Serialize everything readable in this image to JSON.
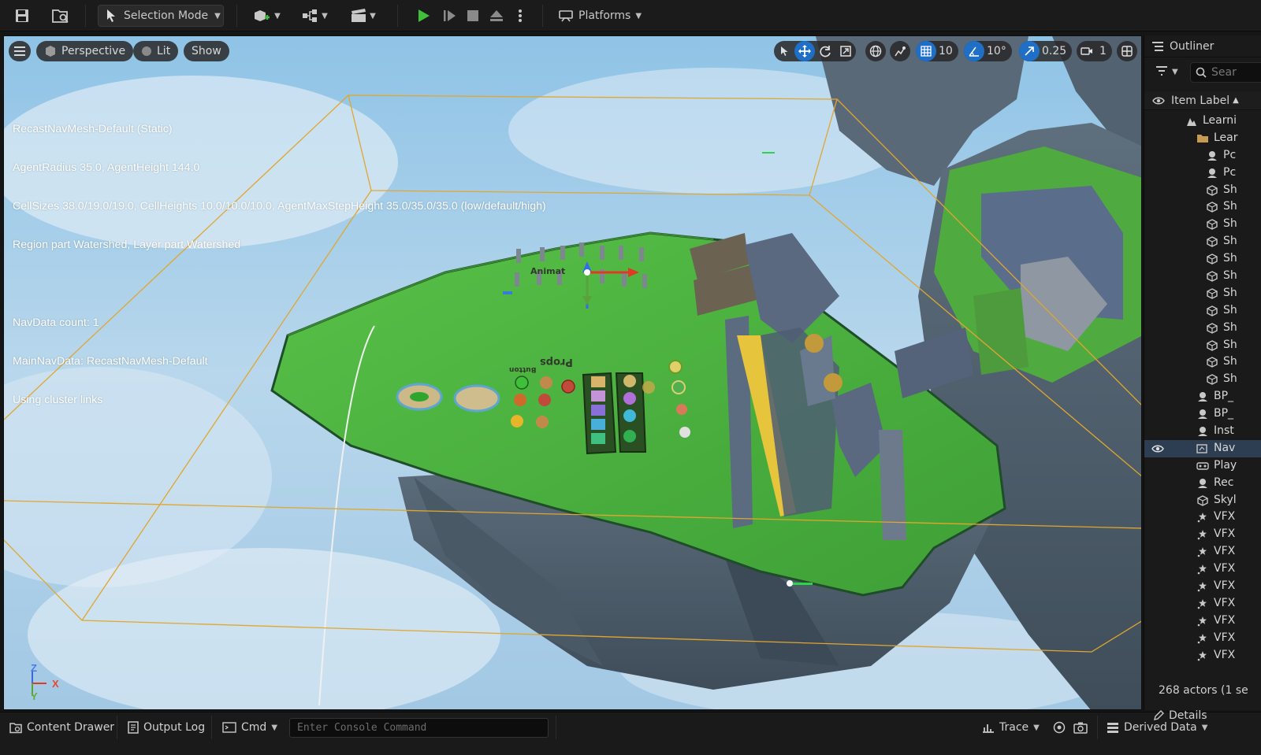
{
  "toolbar": {
    "selection_mode": "Selection Mode",
    "platforms": "Platforms"
  },
  "viewport": {
    "menu_icon": "hamburger-icon",
    "perspective": "Perspective",
    "lit": "Lit",
    "show": "Show",
    "grid_snap": "10",
    "rotation_snap": "10°",
    "scale_snap": "0.25",
    "camera_speed": "1",
    "nav_info": [
      "RecastNavMesh-Default (Static)",
      "AgentRadius 35.0, AgentHeight 144.0",
      "CellSizes 38.0/19.0/19.0, CellHeights 10.0/10.0/10.0, AgentMaxStepHeight 35.0/35.0/35.0 (low/default/high)",
      "Region part Watershed, Layer part Watershed",
      "",
      "NavData count: 1",
      "MainNavData: RecastNavMesh-Default",
      "Using cluster links"
    ],
    "scene_labels": {
      "animation": "Animat",
      "props": "Props",
      "button": "Button"
    },
    "axis": {
      "z": "Z",
      "x": "X",
      "y": "Y"
    }
  },
  "outliner": {
    "title": "Outliner",
    "search_placeholder": "Sear",
    "column_label": "Item Label",
    "rows": [
      {
        "label": "Learni",
        "icon": "level-icon",
        "indent": 1
      },
      {
        "label": "Lear",
        "icon": "folder-icon",
        "indent": 2
      },
      {
        "label": "Pc",
        "icon": "actor-icon",
        "indent": 3
      },
      {
        "label": "Pc",
        "icon": "actor-icon",
        "indent": 3
      },
      {
        "label": "Sh",
        "icon": "static-mesh-icon",
        "indent": 3
      },
      {
        "label": "Sh",
        "icon": "static-mesh-icon",
        "indent": 3
      },
      {
        "label": "Sh",
        "icon": "static-mesh-icon",
        "indent": 3
      },
      {
        "label": "Sh",
        "icon": "static-mesh-icon",
        "indent": 3
      },
      {
        "label": "Sh",
        "icon": "static-mesh-icon",
        "indent": 3
      },
      {
        "label": "Sh",
        "icon": "static-mesh-icon",
        "indent": 3
      },
      {
        "label": "Sh",
        "icon": "static-mesh-icon",
        "indent": 3
      },
      {
        "label": "Sh",
        "icon": "static-mesh-icon",
        "indent": 3
      },
      {
        "label": "Sh",
        "icon": "static-mesh-icon",
        "indent": 3
      },
      {
        "label": "Sh",
        "icon": "static-mesh-icon",
        "indent": 3
      },
      {
        "label": "Sh",
        "icon": "static-mesh-icon",
        "indent": 3
      },
      {
        "label": "Sh",
        "icon": "static-mesh-icon",
        "indent": 3
      },
      {
        "label": "BP_",
        "icon": "actor-icon",
        "indent": 2
      },
      {
        "label": "BP_",
        "icon": "actor-icon",
        "indent": 2
      },
      {
        "label": "Inst",
        "icon": "actor-icon",
        "indent": 2
      },
      {
        "label": "Nav",
        "icon": "navmesh-icon",
        "indent": 2,
        "selected": true
      },
      {
        "label": "Play",
        "icon": "player-start-icon",
        "indent": 2
      },
      {
        "label": "Rec",
        "icon": "actor-icon",
        "indent": 2
      },
      {
        "label": "Skyl",
        "icon": "static-mesh-icon",
        "indent": 2
      },
      {
        "label": "VFX",
        "icon": "vfx-icon",
        "indent": 2
      },
      {
        "label": "VFX",
        "icon": "vfx-icon",
        "indent": 2
      },
      {
        "label": "VFX",
        "icon": "vfx-icon",
        "indent": 2
      },
      {
        "label": "VFX",
        "icon": "vfx-icon",
        "indent": 2
      },
      {
        "label": "VFX",
        "icon": "vfx-icon",
        "indent": 2
      },
      {
        "label": "VFX",
        "icon": "vfx-icon",
        "indent": 2
      },
      {
        "label": "VFX",
        "icon": "vfx-icon",
        "indent": 2
      },
      {
        "label": "VFX",
        "icon": "vfx-icon",
        "indent": 2
      },
      {
        "label": "VFX",
        "icon": "vfx-icon",
        "indent": 2
      }
    ],
    "actor_count": "268 actors (1 se"
  },
  "bottombar": {
    "content_drawer": "Content Drawer",
    "output_log": "Output Log",
    "cmd": "Cmd",
    "console_placeholder": "Enter Console Command",
    "trace": "Trace",
    "derived_data": "Derived Data",
    "details": "Details"
  },
  "colors": {
    "play_green": "#3fbf3a",
    "accent_blue": "#1f6fc7",
    "navmesh_green": "#4cb33e",
    "bounds_orange": "#e0a630"
  }
}
